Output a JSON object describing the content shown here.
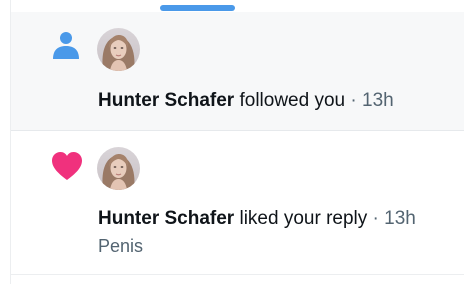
{
  "colors": {
    "accent": "#4a99e9",
    "like_pink": "#f0317d",
    "follow_blue": "#4a99e9",
    "meta_gray": "#536471"
  },
  "notifications": [
    {
      "type": "follow",
      "icon": "person-icon",
      "user_name": "Hunter Schafer",
      "action_text": " followed you",
      "separator": " · ",
      "time": "13h"
    },
    {
      "type": "like",
      "icon": "heart-icon",
      "user_name": "Hunter Schafer",
      "action_text": " liked your reply",
      "separator": " · ",
      "time": "13h",
      "snippet": "Penis"
    }
  ]
}
